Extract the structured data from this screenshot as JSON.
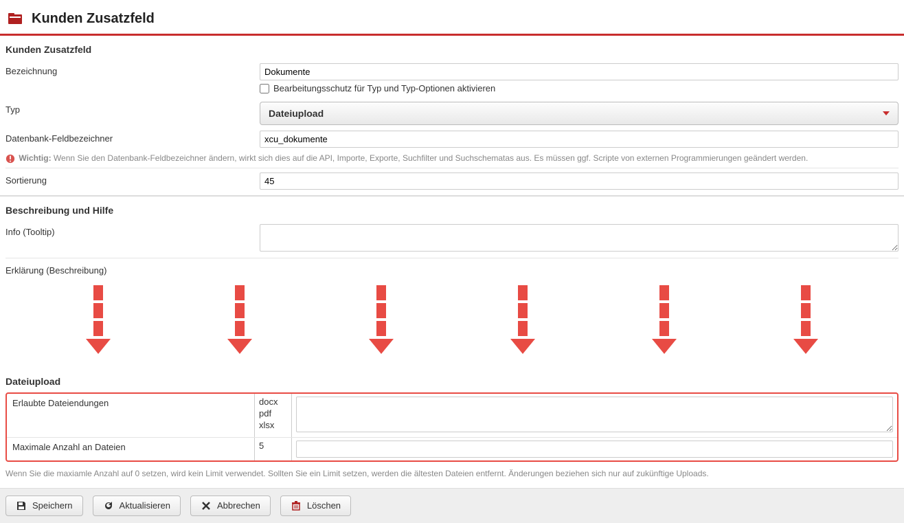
{
  "header": {
    "title": "Kunden Zusatzfeld"
  },
  "section1": {
    "title": "Kunden Zusatzfeld"
  },
  "fields": {
    "bezeichnung": {
      "label": "Bezeichnung",
      "value": "Dokumente"
    },
    "edit_protect": {
      "label": "Bearbeitungsschutz für Typ und Typ-Optionen aktivieren"
    },
    "typ": {
      "label": "Typ",
      "value": "Dateiupload"
    },
    "db_field": {
      "label": "Datenbank-Feldbezeichner",
      "value": "xcu_dokumente"
    },
    "warning": {
      "prefix": "Wichtig:",
      "text": "Wenn Sie den Datenbank-Feldbezeichner ändern, wirkt sich dies auf die API, Importe, Exporte, Suchfilter und Suchschematas aus. Es müssen ggf. Scripte von externen Programmierungen geändert werden."
    },
    "sortierung": {
      "label": "Sortierung",
      "value": "45"
    }
  },
  "section2": {
    "title": "Beschreibung und Hilfe"
  },
  "fields2": {
    "info": {
      "label": "Info (Tooltip)",
      "value": ""
    },
    "erklaerung": {
      "label": "Erklärung (Beschreibung)"
    }
  },
  "section3": {
    "title": "Dateiupload"
  },
  "upload": {
    "ext": {
      "label": "Erlaubte Dateiendungen",
      "value": "docx\npdf\nxlsx"
    },
    "max": {
      "label": "Maximale Anzahl an Dateien",
      "value": "5"
    },
    "note": "Wenn Sie die maxiamle Anzahl auf 0 setzen, wird kein Limit verwendet. Sollten Sie ein Limit setzen, werden die ältesten Dateien entfernt. Änderungen beziehen sich nur auf zukünftige Uploads."
  },
  "buttons": {
    "save": "Speichern",
    "refresh": "Aktualisieren",
    "cancel": "Abbrechen",
    "delete": "Löschen"
  }
}
